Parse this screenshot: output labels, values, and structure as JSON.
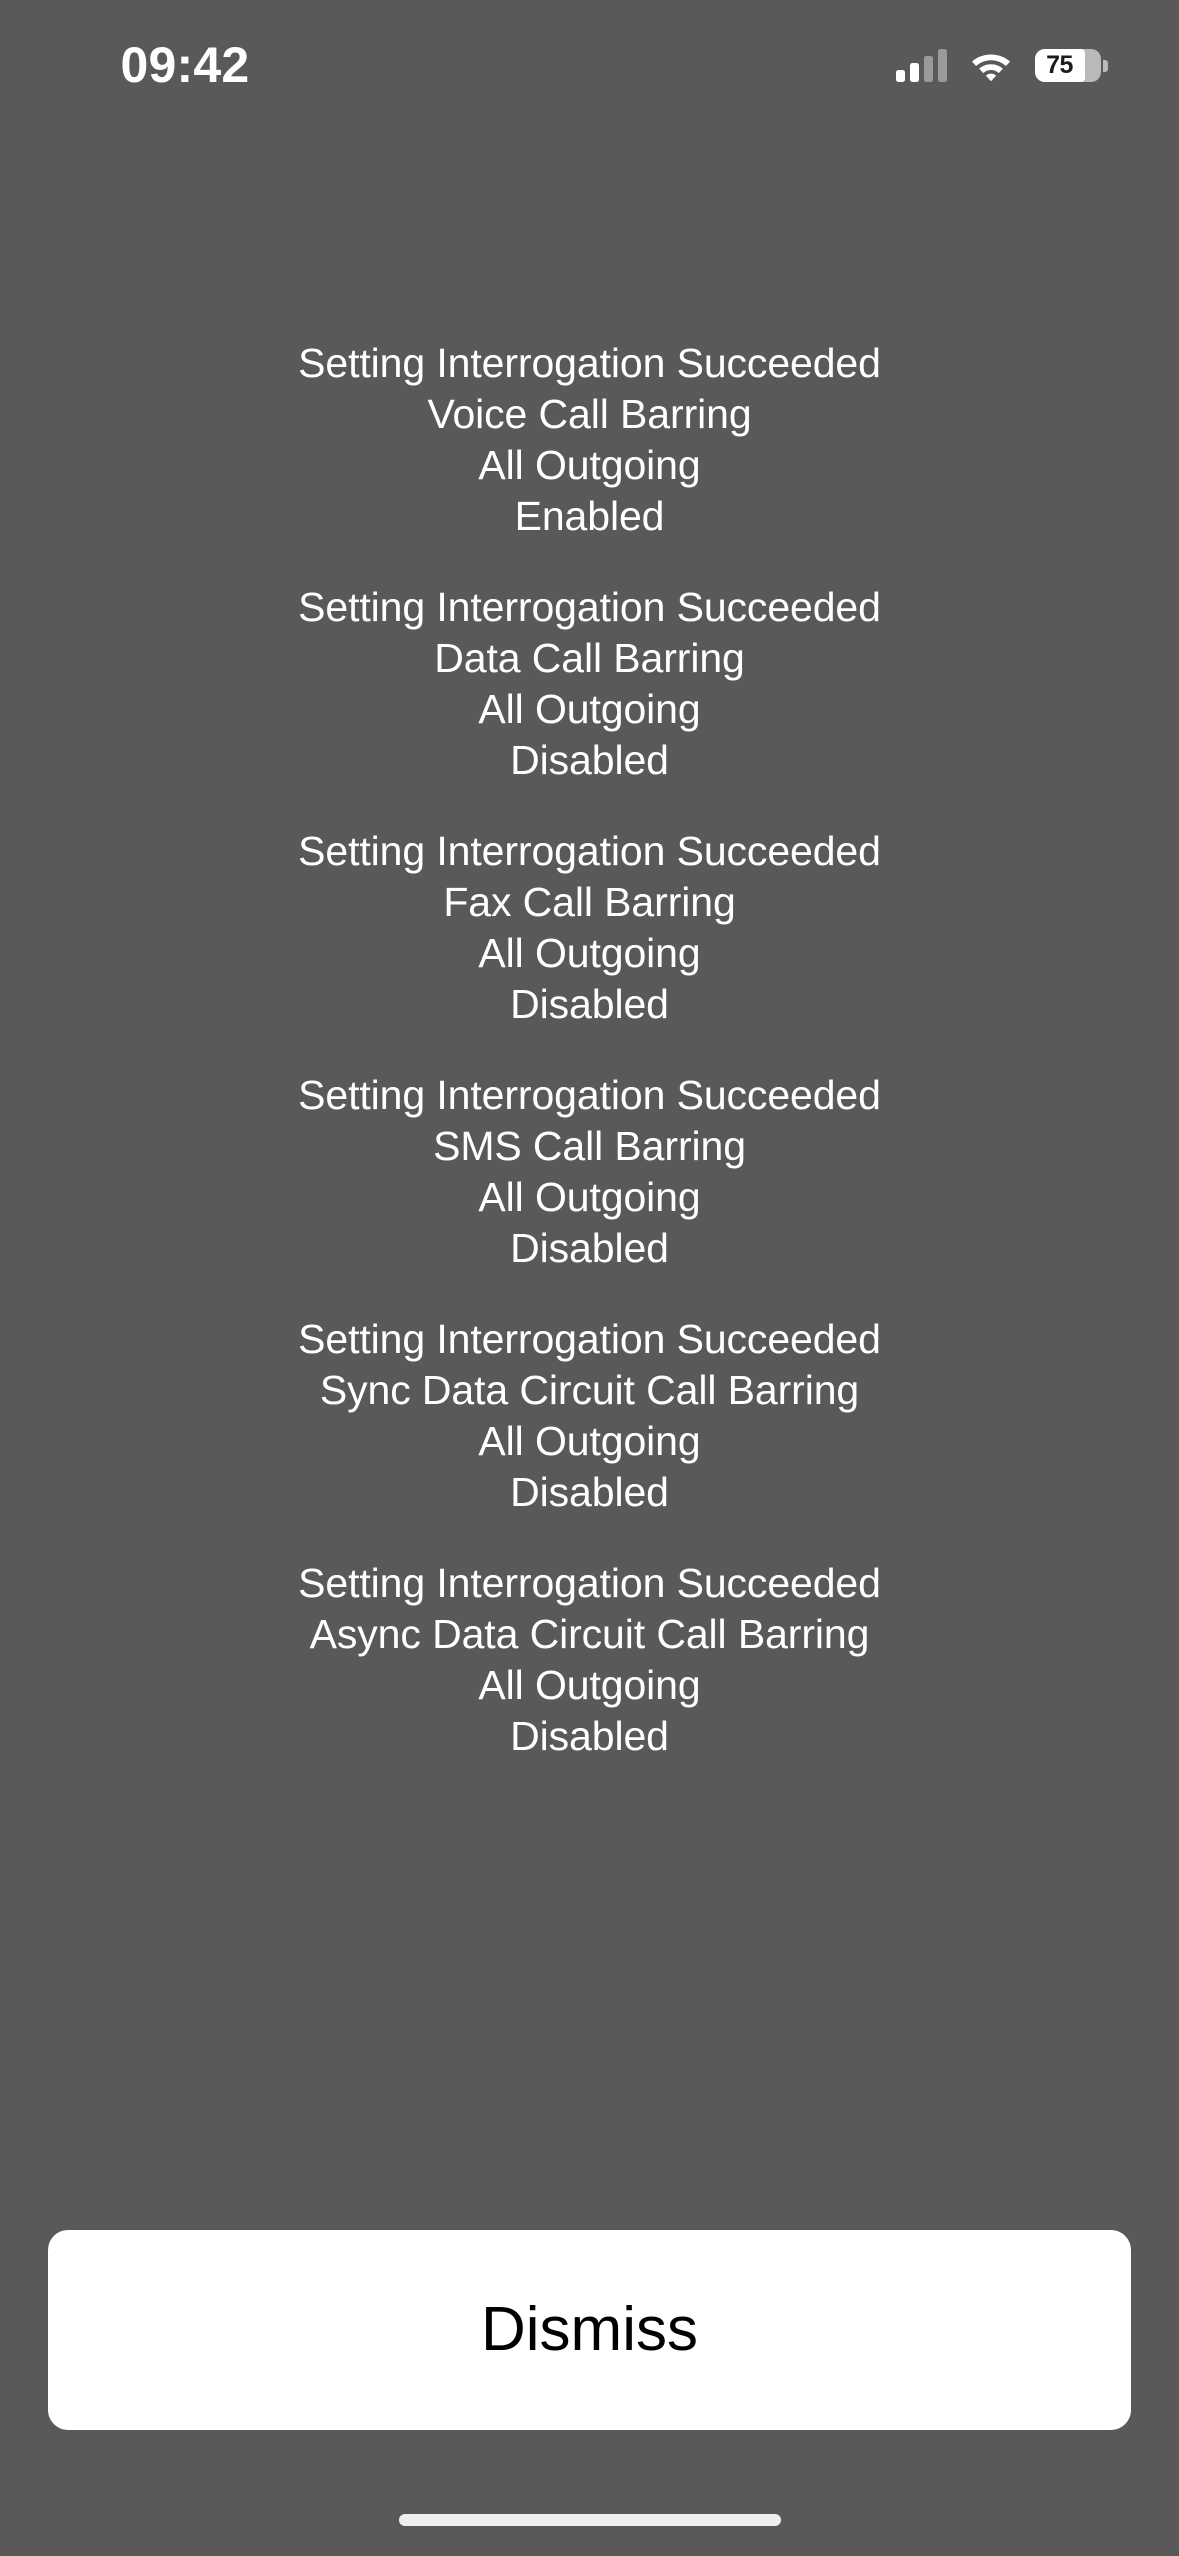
{
  "theme": {
    "overlay_background": "#595959",
    "text_color": "#ffffff",
    "button_background": "#ffffff",
    "button_text_color": "#000000",
    "home_indicator_color": "#efefef"
  },
  "status_bar": {
    "time": "09:42",
    "signal": {
      "icon": "cellular-signal-icon",
      "bars_filled": 2,
      "bars_total": 4
    },
    "wifi": {
      "icon": "wifi-icon",
      "strength": 3
    },
    "battery": {
      "icon": "battery-icon",
      "percent": "75",
      "fill_ratio": 0.75
    }
  },
  "alerts": [
    {
      "title": "Setting Interrogation Succeeded",
      "service": "Voice Call Barring",
      "scope": "All Outgoing",
      "state": "Enabled"
    },
    {
      "title": "Setting Interrogation Succeeded",
      "service": "Data Call Barring",
      "scope": "All Outgoing",
      "state": "Disabled"
    },
    {
      "title": "Setting Interrogation Succeeded",
      "service": "Fax Call Barring",
      "scope": "All Outgoing",
      "state": "Disabled"
    },
    {
      "title": "Setting Interrogation Succeeded",
      "service": "SMS Call Barring",
      "scope": "All Outgoing",
      "state": "Disabled"
    },
    {
      "title": "Setting Interrogation Succeeded",
      "service": "Sync Data Circuit Call Barring",
      "scope": "All Outgoing",
      "state": "Disabled"
    },
    {
      "title": "Setting Interrogation Succeeded",
      "service": "Async Data Circuit Call Barring",
      "scope": "All Outgoing",
      "state": "Disabled"
    }
  ],
  "footer": {
    "dismiss_label": "Dismiss"
  }
}
